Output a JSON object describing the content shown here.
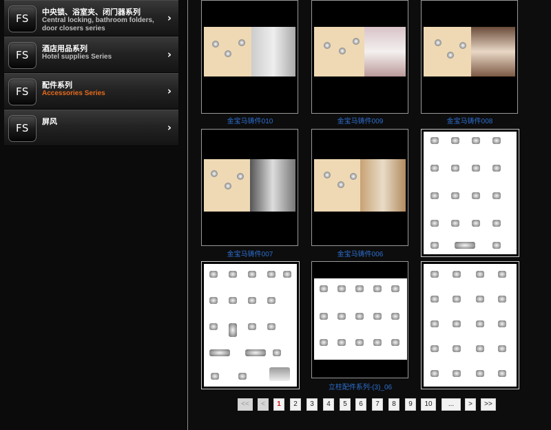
{
  "sidebar": {
    "logo_text": "FS",
    "items": [
      {
        "title": "中央锁、浴室夹、闭门器系列",
        "subtitle": "Central locking, bathroom folders, door closers series",
        "active": false
      },
      {
        "title": "酒店用品系列",
        "subtitle": "Hotel supplies Series",
        "active": false
      },
      {
        "title": "配件系列",
        "subtitle": "Accessories Series",
        "active": true
      },
      {
        "title": "屏风",
        "subtitle": "",
        "active": false
      }
    ],
    "chevron": "›"
  },
  "products": [
    {
      "caption": "金宝马铸件010"
    },
    {
      "caption": "金宝马铸件009"
    },
    {
      "caption": "金宝马铸件008"
    },
    {
      "caption": "金宝马铸件007"
    },
    {
      "caption": "金宝马铸件006"
    },
    {
      "caption": ""
    },
    {
      "caption": ""
    },
    {
      "caption": "立柱配件系列-(3)_06"
    },
    {
      "caption": ""
    }
  ],
  "pagination": {
    "first": "<<",
    "prev": "<",
    "pages": [
      "1",
      "2",
      "3",
      "4",
      "5",
      "6",
      "7",
      "8",
      "9",
      "10"
    ],
    "current": "1",
    "ellipsis": "...",
    "next": ">",
    "last": ">>"
  },
  "colors": {
    "accent_active": "#e86b1c",
    "caption_link": "#2d6fd0",
    "current_page": "#cc1111"
  }
}
